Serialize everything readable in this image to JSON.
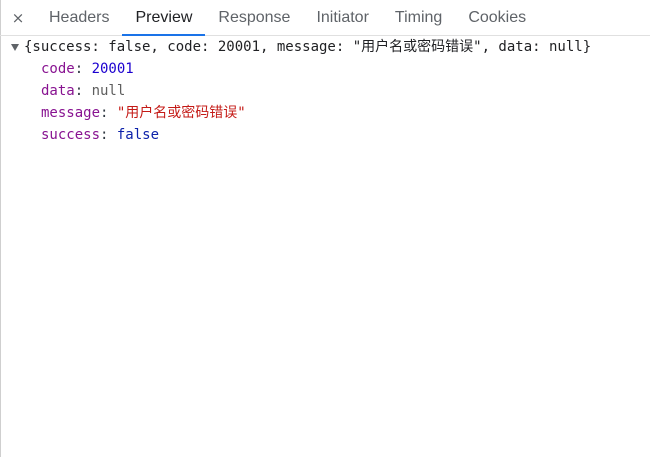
{
  "tabs": {
    "close_symbol": "×",
    "items": [
      "Headers",
      "Preview",
      "Response",
      "Initiator",
      "Timing",
      "Cookies"
    ],
    "active": "Preview"
  },
  "summary": "{success: false, code: 20001, message: \"用户名或密码错误\", data: null}",
  "properties": {
    "code": {
      "key": "code",
      "value": "20001"
    },
    "data": {
      "key": "data",
      "value": "null"
    },
    "message": {
      "key": "message",
      "value": "\"用户名或密码错误\""
    },
    "success": {
      "key": "success",
      "value": "false"
    }
  },
  "colors": {
    "active_tab_underline": "#1a73e8",
    "key": "#881391",
    "number": "#1c00cf",
    "string": "#c41a16",
    "boolean": "#0d22aa",
    "null": "#5e5e5e"
  }
}
